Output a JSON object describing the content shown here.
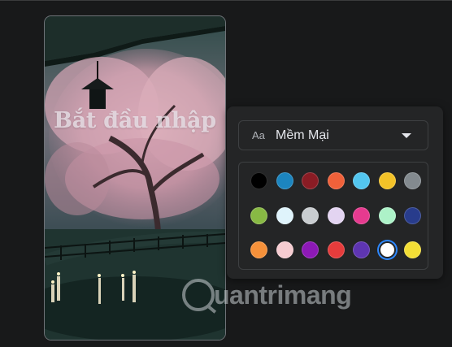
{
  "story": {
    "text": "Bắt đầu nhập"
  },
  "font_picker": {
    "icon_label": "Aa",
    "selected_font": "Mềm Mại"
  },
  "colors": [
    [
      "#000000",
      "#1c85bf",
      "#8a1c24",
      "#f0613a",
      "#53c6ef",
      "#f3c228",
      "#838a8f"
    ],
    [
      "#88b944",
      "#dff3fb",
      "#c9cdd0",
      "#e3d4f1",
      "#e63a8f",
      "#adf2c8",
      "#283c8c"
    ],
    [
      "#f6913a",
      "#f6ccd1",
      "#8d19b6",
      "#e63c3c",
      "#5e35b1",
      "#ffffff",
      "#f3de36"
    ]
  ],
  "selected_color": "#ffffff",
  "watermark": {
    "text": "uantrimang"
  }
}
